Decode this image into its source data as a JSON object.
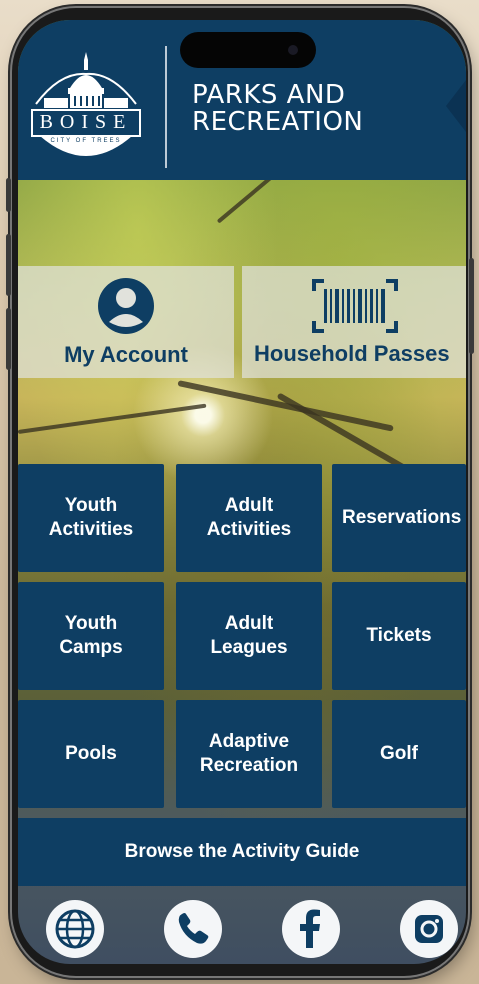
{
  "header": {
    "logo_text": "BOISE",
    "logo_subtext": "CITY OF TREES",
    "title_line1": "PARKS AND",
    "title_line2": "RECREATION"
  },
  "quick_links": [
    {
      "label": "My Account",
      "icon": "user-circle-icon"
    },
    {
      "label": "Household Passes",
      "icon": "barcode-scan-icon"
    }
  ],
  "tiles": [
    {
      "label": "Youth\nActivities"
    },
    {
      "label": "Adult\nActivities"
    },
    {
      "label": "Reservations"
    },
    {
      "label": "Youth\nCamps"
    },
    {
      "label": "Adult\nLeagues"
    },
    {
      "label": "Tickets"
    },
    {
      "label": "Pools"
    },
    {
      "label": "Adaptive\nRecreation"
    },
    {
      "label": "Golf"
    }
  ],
  "browse_label": "Browse the Activity Guide",
  "social_icons": [
    "globe-icon",
    "phone-icon",
    "facebook-icon",
    "instagram-icon"
  ],
  "colors": {
    "primary": "#0e3e63",
    "tile_text": "#ffffff",
    "quick_bg": "#e1e2dc"
  }
}
